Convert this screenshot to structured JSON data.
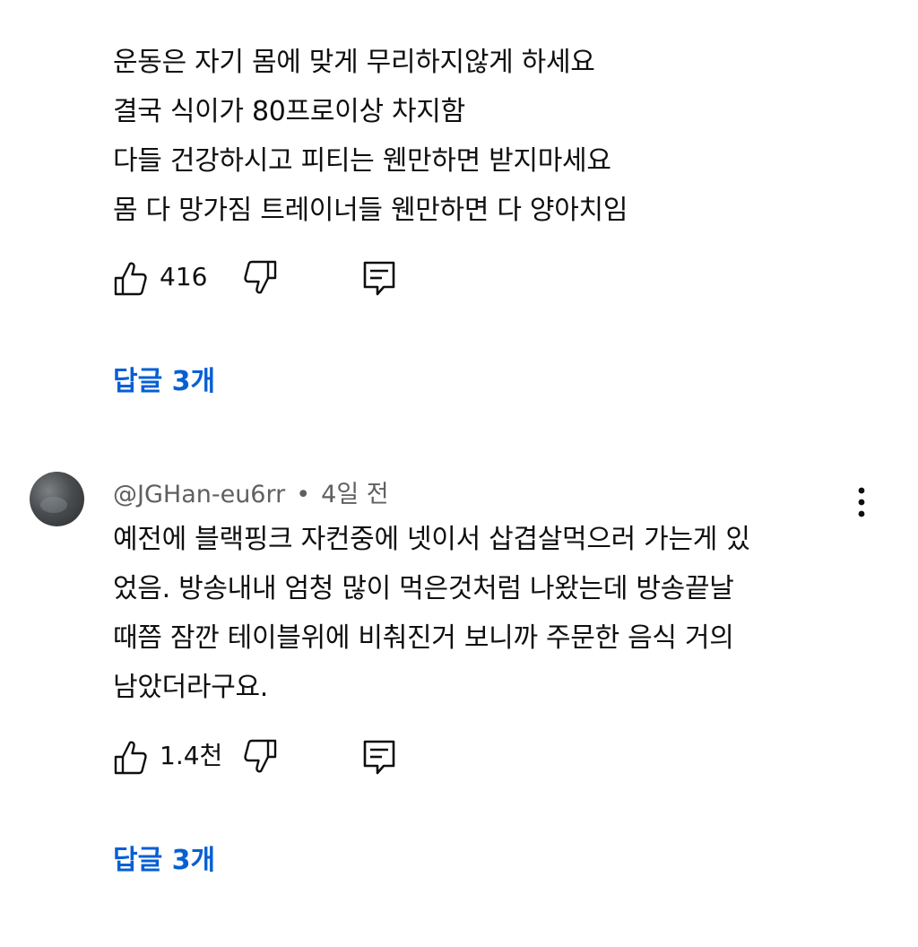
{
  "comments": [
    {
      "author": "",
      "age": "",
      "lines": [
        "운동은 자기 몸에 맞게 무리하지않게 하세요",
        "결국 식이가 80프로이상 차지함",
        "다들 건강하시고 피티는 웬만하면 받지마세요",
        "몸 다 망가짐 트레이너들 웬만하면 다 양아치임"
      ],
      "likes": "416",
      "replies_label": "답글 3개"
    },
    {
      "author": "@JGHan-eu6rr",
      "separator": "•",
      "age": "4일 전",
      "lines": [
        "예전에 블랙핑크 자컨중에 넷이서 삽겹살먹으러 가는게 있",
        "었음. 방송내내 엄청 많이 먹은것처럼 나왔는데 방송끝날",
        "때쯤 잠깐 테이블위에 비춰진거 보니까 주문한 음식 거의",
        "남았더라구요."
      ],
      "likes": "1.4천",
      "replies_label": "답글 3개"
    }
  ],
  "icons": {
    "like": "thumbs-up-icon",
    "dislike": "thumbs-down-icon",
    "reply": "reply-icon",
    "more": "more-vertical-icon"
  },
  "colors": {
    "text": "#0f0f0f",
    "secondary": "#606060",
    "link": "#065fd4"
  }
}
